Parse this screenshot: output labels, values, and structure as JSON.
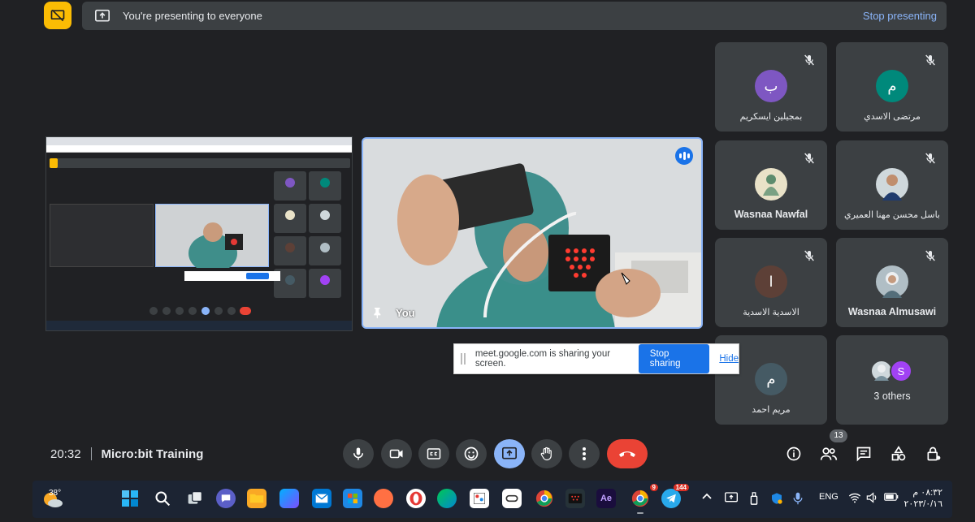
{
  "presenting_bar": {
    "message": "You're presenting to everyone",
    "stop_label": "Stop presenting"
  },
  "self_view": {
    "name": "You"
  },
  "participants": [
    {
      "name": "بمجيلين ايسكريم",
      "initial": "ب",
      "color": "#7e57c2"
    },
    {
      "name": "مرتضى الاسدي",
      "initial": "م",
      "color": "#00897b"
    },
    {
      "name": "Wasnaa Nawfal",
      "initial": "",
      "color": "#e9e2c8"
    },
    {
      "name": "باسل محسن مهنا العميري",
      "initial": "",
      "color": "#cfd8dc"
    },
    {
      "name": "الاسدية الاسدية",
      "initial": "ا",
      "color": "#5d4037"
    },
    {
      "name": "Wasnaa Almusawi",
      "initial": "",
      "color": "#b0bec5"
    },
    {
      "name": "مريم احمد",
      "initial": "م",
      "color": "#455a64"
    }
  ],
  "others_tile": {
    "label": "3 others",
    "initial": "S",
    "color": "#a142f4"
  },
  "share_notice": {
    "text": "meet.google.com is sharing your screen.",
    "stop_label": "Stop sharing",
    "hide_label": "Hide"
  },
  "meeting": {
    "time": "20:32",
    "title": "Micro:bit Training",
    "people_count": "13"
  },
  "taskbar": {
    "temperature": "38°",
    "language": "ENG",
    "clock_time": "٠٨:٣٢ م",
    "clock_date": "٢٠٢٣/٠/١٦",
    "chrome_badge": "9",
    "telegram_badge": "144"
  },
  "colors": {
    "background": "#202124",
    "tile": "#3c4043",
    "accent": "#8ab4f8",
    "presenting": "#fbbc04",
    "end_call": "#ea4335"
  }
}
